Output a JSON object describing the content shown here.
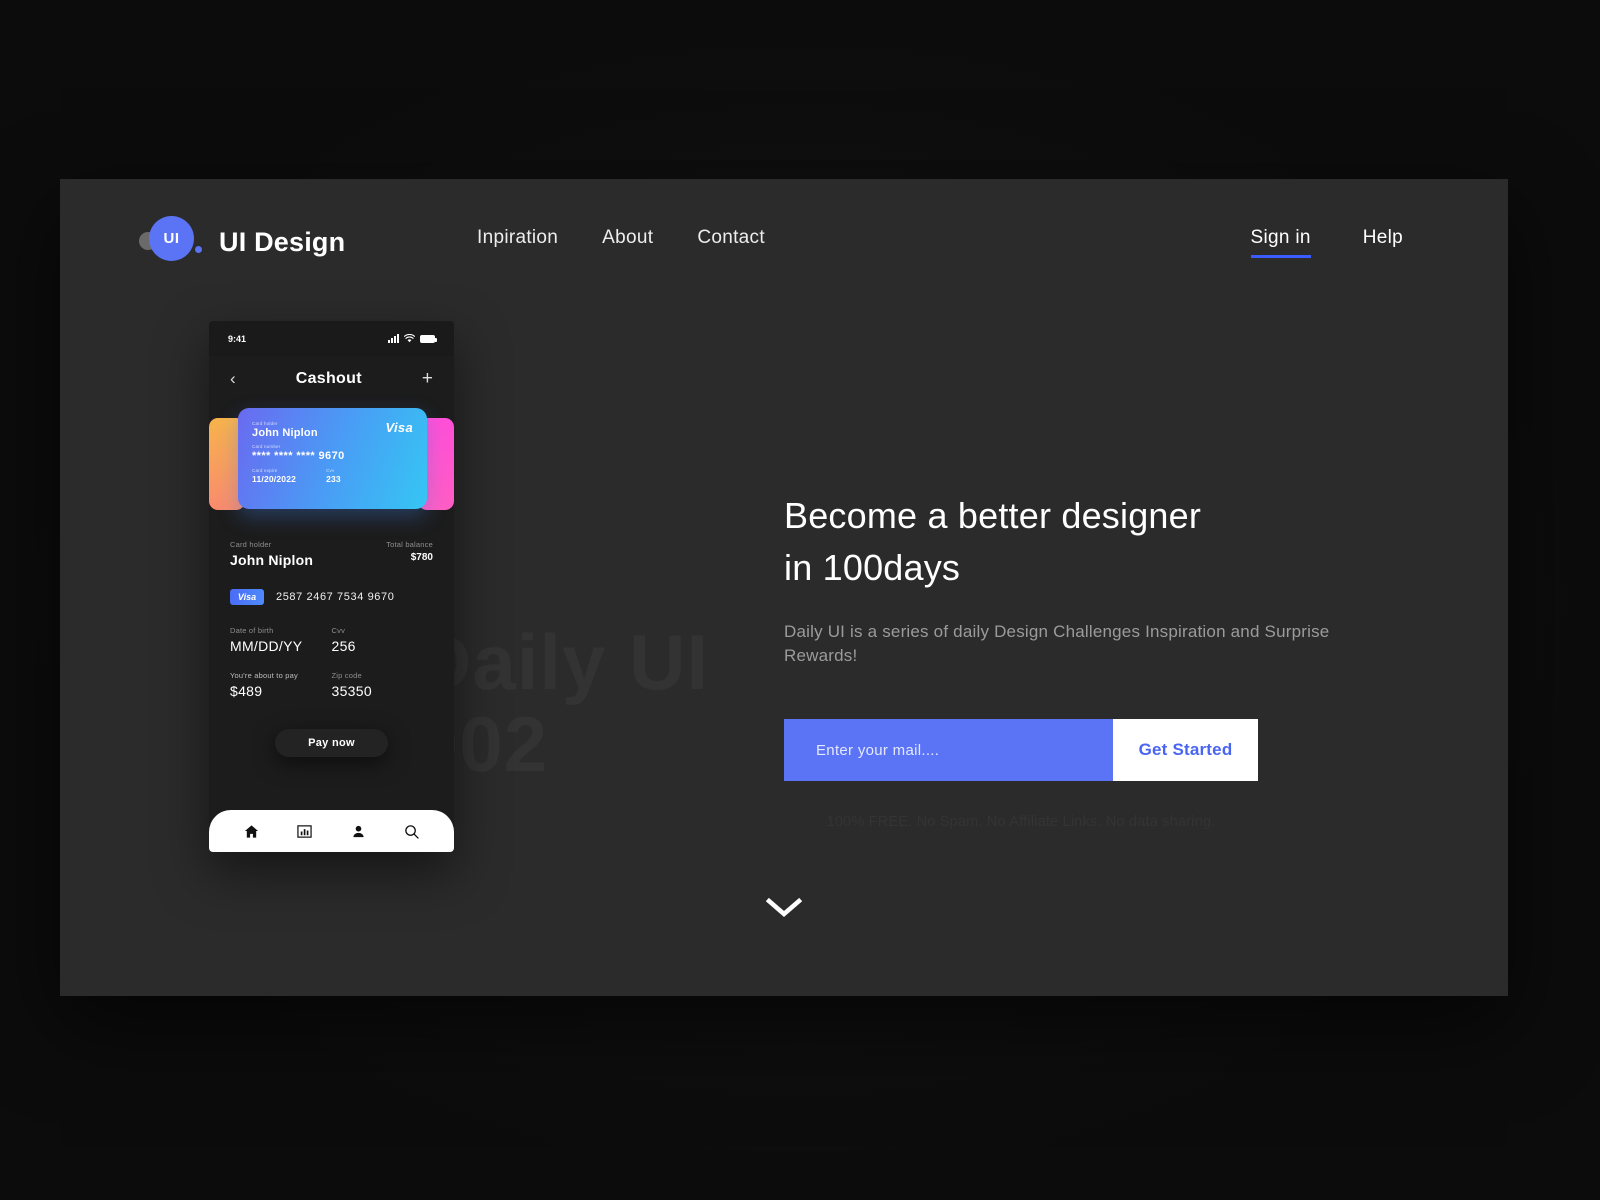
{
  "brand": {
    "mark_text": "UI",
    "name": "UI Design"
  },
  "nav": {
    "items": [
      {
        "label": "Inpiration"
      },
      {
        "label": "About"
      },
      {
        "label": "Contact"
      }
    ],
    "right": [
      {
        "label": "Sign in",
        "active": true
      },
      {
        "label": "Help",
        "active": false
      }
    ]
  },
  "watermark": {
    "line1": "Daily UI",
    "line2": "002"
  },
  "phone": {
    "statusbar": {
      "time": "9:41",
      "icons": [
        "signal-icon",
        "wifi-icon",
        "battery-icon"
      ]
    },
    "header": {
      "back": "‹",
      "title": "Cashout",
      "add": "+"
    },
    "card": {
      "brand": "Visa",
      "holder_label": "Card holder",
      "holder": "John Niplon",
      "number_label": "Card number",
      "number": "**** **** **** 9670",
      "expire_label": "Card expire",
      "expire": "11/20/2022",
      "cvv_label": "Cvv",
      "cvv": "233"
    },
    "details": {
      "holder_label": "Card holder",
      "holder": "John Niplon",
      "balance_label": "Total balance",
      "balance": "$780",
      "visa_badge": "Visa",
      "card_number": "2587 2467 7534 9670",
      "dob_label": "Date of birth",
      "dob": "MM/DD/YY",
      "cvv_label": "Cvv",
      "cvv": "256",
      "pay_label": "You're about to pay",
      "pay_amount": "$489",
      "zip_label": "Zip code",
      "zip": "35350"
    },
    "pay_button": "Pay now",
    "bottom_nav": [
      {
        "icon": "home-icon"
      },
      {
        "icon": "chart-icon"
      },
      {
        "icon": "person-icon"
      },
      {
        "icon": "search-icon"
      }
    ]
  },
  "hero": {
    "headline_line1": "Become a better designer",
    "headline_line2": "in 100days",
    "subtext": "Daily UI is a series of daily Design Challenges Inspiration and Surprise Rewards!",
    "email_placeholder": "Enter your mail....",
    "email_value": "",
    "cta_label": "Get Started",
    "fineprint": "100% FREE. No Spam. No Affiliate Links. No data sharing."
  },
  "scroll_indicator": "chevron-down-icon",
  "colors": {
    "accent_blue": "#5b73f5",
    "panel_bg": "#2b2b2b",
    "page_bg": "#0e0e0e",
    "card_orange": "#f7b34c",
    "card_pink": "#ff4fd8"
  }
}
